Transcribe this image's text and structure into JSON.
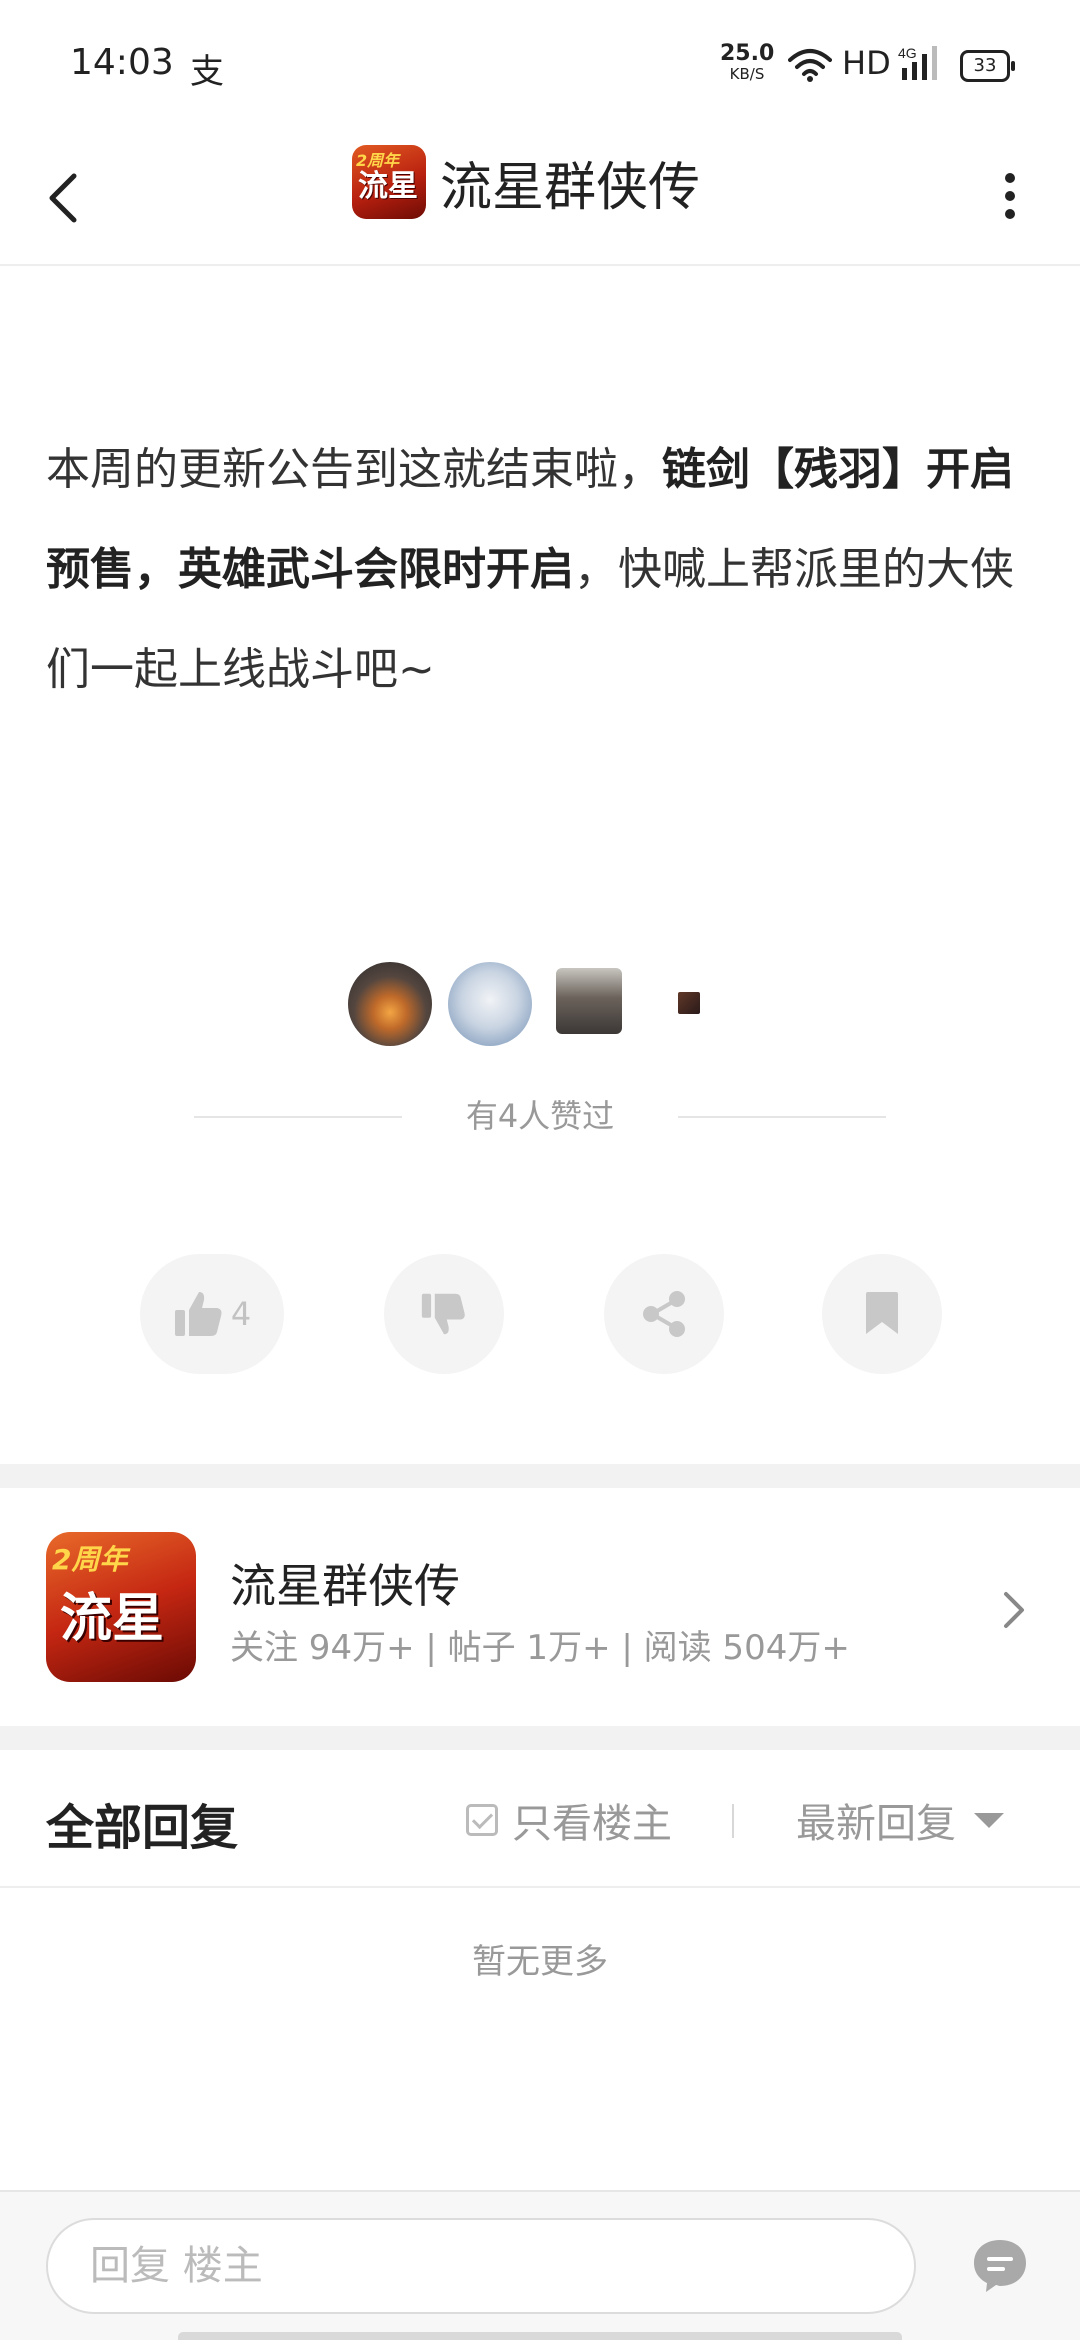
{
  "status_bar": {
    "time": "14:03",
    "app_glyph": "支",
    "net_speed_value": "25.0",
    "net_speed_unit": "KB/S",
    "hd_label": "HD",
    "network_type": "4G",
    "battery_level": "33"
  },
  "header": {
    "title": "流星群侠传",
    "logo_badge": "2周年",
    "logo_text": "流星"
  },
  "post": {
    "text_normal_1": "本周的更新公告到这就结束啦，",
    "text_bold_1": "链剑【残羽】开启预售，英雄武斗会限时开启",
    "text_normal_2": "，快喊上帮派里的大侠们一起上线战斗吧~"
  },
  "likes": {
    "summary": "有4人赞过",
    "like_count": "4"
  },
  "game_card": {
    "logo_badge": "2周年",
    "logo_text": "流星",
    "name": "流星群侠传",
    "stats": "关注 94万+ | 帖子 1万+ | 阅读 504万+"
  },
  "replies": {
    "title": "全部回复",
    "only_op_label": "只看楼主",
    "sort_label": "最新回复",
    "empty_text": "暂无更多"
  },
  "bottom_bar": {
    "reply_placeholder": "回复  楼主"
  },
  "colors": {
    "background": "#ffffff",
    "separator": "#f2f2f2",
    "muted_text": "#999999",
    "brand_red": "#c52712"
  }
}
